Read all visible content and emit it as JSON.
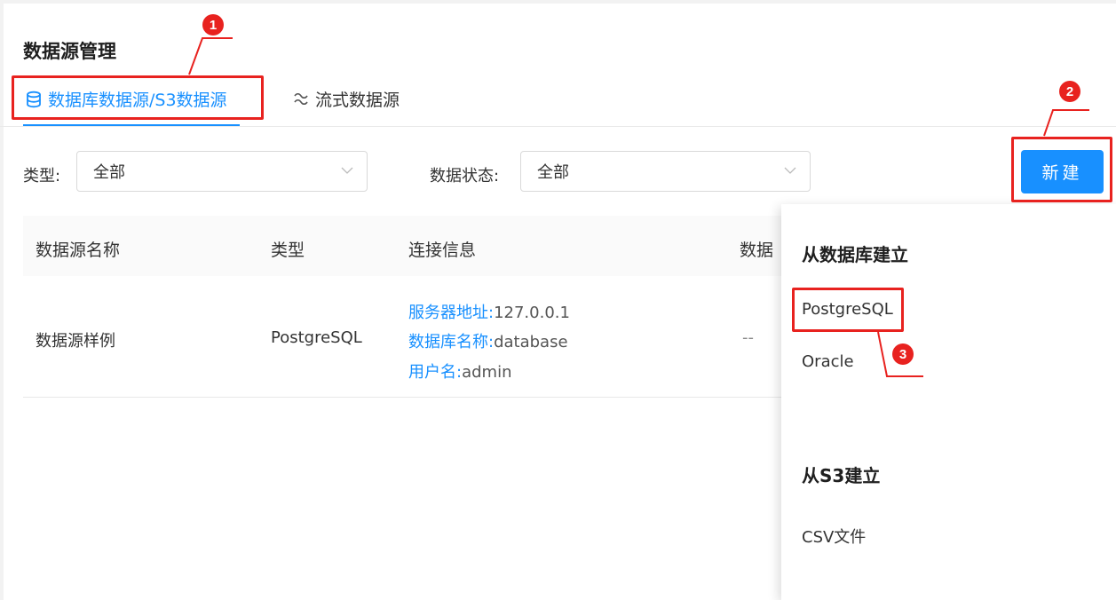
{
  "page": {
    "title": "数据源管理"
  },
  "tabs": [
    {
      "label": "数据库数据源/S3数据源",
      "icon": "database-icon",
      "active": true
    },
    {
      "label": "流式数据源",
      "icon": "stream-icon",
      "active": false
    }
  ],
  "filters": {
    "type_label": "类型:",
    "type_value": "全部",
    "status_label": "数据状态:",
    "status_value": "全部"
  },
  "toolbar": {
    "new_label": "新建"
  },
  "table": {
    "headers": [
      "数据源名称",
      "类型",
      "连接信息",
      "数据"
    ],
    "rows": [
      {
        "name": "数据源样例",
        "type": "PostgreSQL",
        "connection": [
          {
            "key": "服务器地址:",
            "value": "127.0.0.1"
          },
          {
            "key": "数据库名称:",
            "value": "database"
          },
          {
            "key": "用户名:",
            "value": "admin"
          }
        ],
        "status": "--"
      }
    ]
  },
  "dropdown": {
    "group_db": "从数据库建立",
    "db_items": [
      "PostgreSQL",
      "Oracle"
    ],
    "group_s3": "从S3建立",
    "s3_items": [
      "CSV文件"
    ]
  },
  "annotations": {
    "step1": "1",
    "step2": "2",
    "step3": "3",
    "color": "#e8221f"
  },
  "colors": {
    "accent": "#1890ff",
    "highlight": "#e8221f"
  }
}
